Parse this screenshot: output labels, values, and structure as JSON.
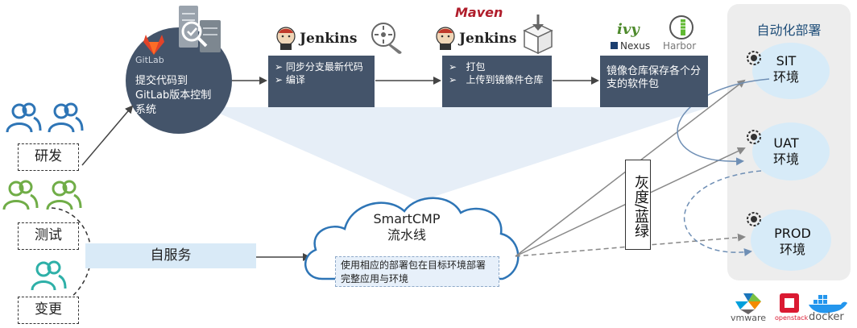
{
  "gitlab": {
    "logo_text": "GitLab",
    "description": "提交代码到GitLab版本控制系统"
  },
  "jenkins1": {
    "logo_text": "Jenkins",
    "items": [
      "同步分支最新代码",
      "编译"
    ]
  },
  "jenkins2": {
    "maven_text": "Maven",
    "logo_text": "Jenkins",
    "items": [
      "打包",
      "上传到镜像件仓库"
    ]
  },
  "repo": {
    "ivy_text": "ivy",
    "nexus_text": "Nexus",
    "harbor_text": "Harbor",
    "description": "镜像仓库保存各个分支的软件包"
  },
  "roles": {
    "dev": "研发",
    "test": "测试",
    "change": "变更"
  },
  "self_service": "自服务",
  "pipeline": {
    "title_line1": "SmartCMP",
    "title_line2": "流水线",
    "desc": "使用相应的部署包在目标环境部署完整应用与环境"
  },
  "release": "灰度/蓝绿",
  "automation": {
    "title": "自动化部署",
    "envs": [
      {
        "name": "SIT",
        "suffix": "环境"
      },
      {
        "name": "UAT",
        "suffix": "环境"
      },
      {
        "name": "PROD",
        "suffix": "环境"
      }
    ]
  },
  "platforms": [
    "vmware",
    "openstack",
    "docker"
  ],
  "colors": {
    "box": "#44546a",
    "env_fill": "#d7ebf8",
    "panel": "#ededed",
    "dev_icon": "#2e75b6",
    "test_icon": "#70ad47",
    "change_icon": "#2eb0a8",
    "self_service_bar": "#d9eaf7"
  }
}
